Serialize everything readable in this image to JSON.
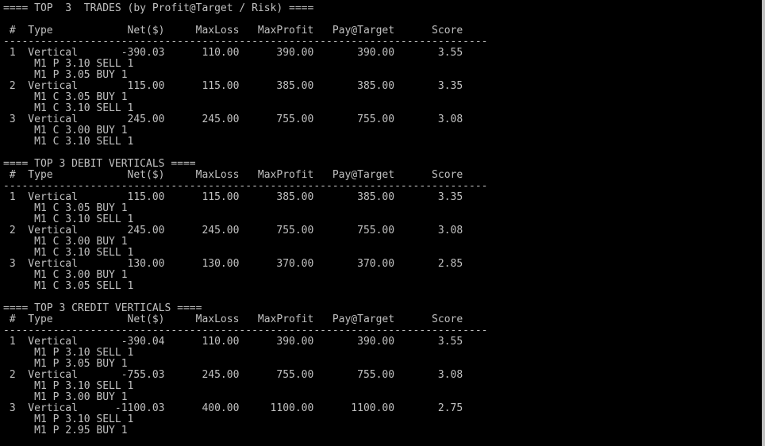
{
  "terminal": {
    "lines": [
      "==== TOP  3  TRADES (by Profit@Target / Risk) ====",
      "",
      " #  Type            Net($)     MaxLoss   MaxProfit   Pay@Target      Score",
      "------------------------------------------------------------------------------",
      " 1  Vertical       -390.03      110.00      390.00       390.00       3.55",
      "     M1 P 3.10 SELL 1",
      "     M1 P 3.05 BUY 1",
      " 2  Vertical        115.00      115.00      385.00       385.00       3.35",
      "     M1 C 3.05 BUY 1",
      "     M1 C 3.10 SELL 1",
      " 3  Vertical        245.00      245.00      755.00       755.00       3.08",
      "     M1 C 3.00 BUY 1",
      "     M1 C 3.10 SELL 1",
      "",
      "==== TOP 3 DEBIT VERTICALS ====",
      " #  Type            Net($)     MaxLoss   MaxProfit   Pay@Target      Score",
      "------------------------------------------------------------------------------",
      " 1  Vertical        115.00      115.00      385.00       385.00       3.35",
      "     M1 C 3.05 BUY 1",
      "     M1 C 3.10 SELL 1",
      " 2  Vertical        245.00      245.00      755.00       755.00       3.08",
      "     M1 C 3.00 BUY 1",
      "     M1 C 3.10 SELL 1",
      " 3  Vertical        130.00      130.00      370.00       370.00       2.85",
      "     M1 C 3.00 BUY 1",
      "     M1 C 3.05 SELL 1",
      "",
      "==== TOP 3 CREDIT VERTICALS ====",
      " #  Type            Net($)     MaxLoss   MaxProfit   Pay@Target      Score",
      "------------------------------------------------------------------------------",
      " 1  Vertical       -390.04      110.00      390.00       390.00       3.55",
      "     M1 P 3.10 SELL 1",
      "     M1 P 3.05 BUY 1",
      " 2  Vertical       -755.03      245.00      755.00       755.00       3.08",
      "     M1 P 3.10 SELL 1",
      "     M1 P 3.00 BUY 1",
      " 3  Vertical      -1100.03      400.00     1100.00      1100.00       2.75",
      "     M1 P 3.10 SELL 1",
      "     M1 P 2.95 BUY 1"
    ]
  }
}
